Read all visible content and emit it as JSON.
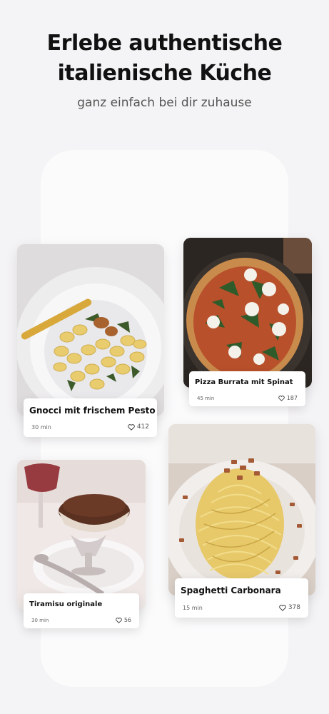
{
  "header": {
    "title_line1": "Erlebe authentische",
    "title_line2": "italienische Küche",
    "subtitle": "ganz einfach bei dir zuhause"
  },
  "recipes": [
    {
      "name": "Gnocci mit frischem Pesto",
      "time": "30 min",
      "likes": "412"
    },
    {
      "name": "Pizza Burrata mit Spinat",
      "time": "45 min",
      "likes": "187"
    },
    {
      "name": "Tiramisu originale",
      "time": "30 min",
      "likes": "56"
    },
    {
      "name": "Spaghetti Carbonara",
      "time": "15 min",
      "likes": "378"
    }
  ],
  "icons": {
    "like": "heart-icon"
  }
}
